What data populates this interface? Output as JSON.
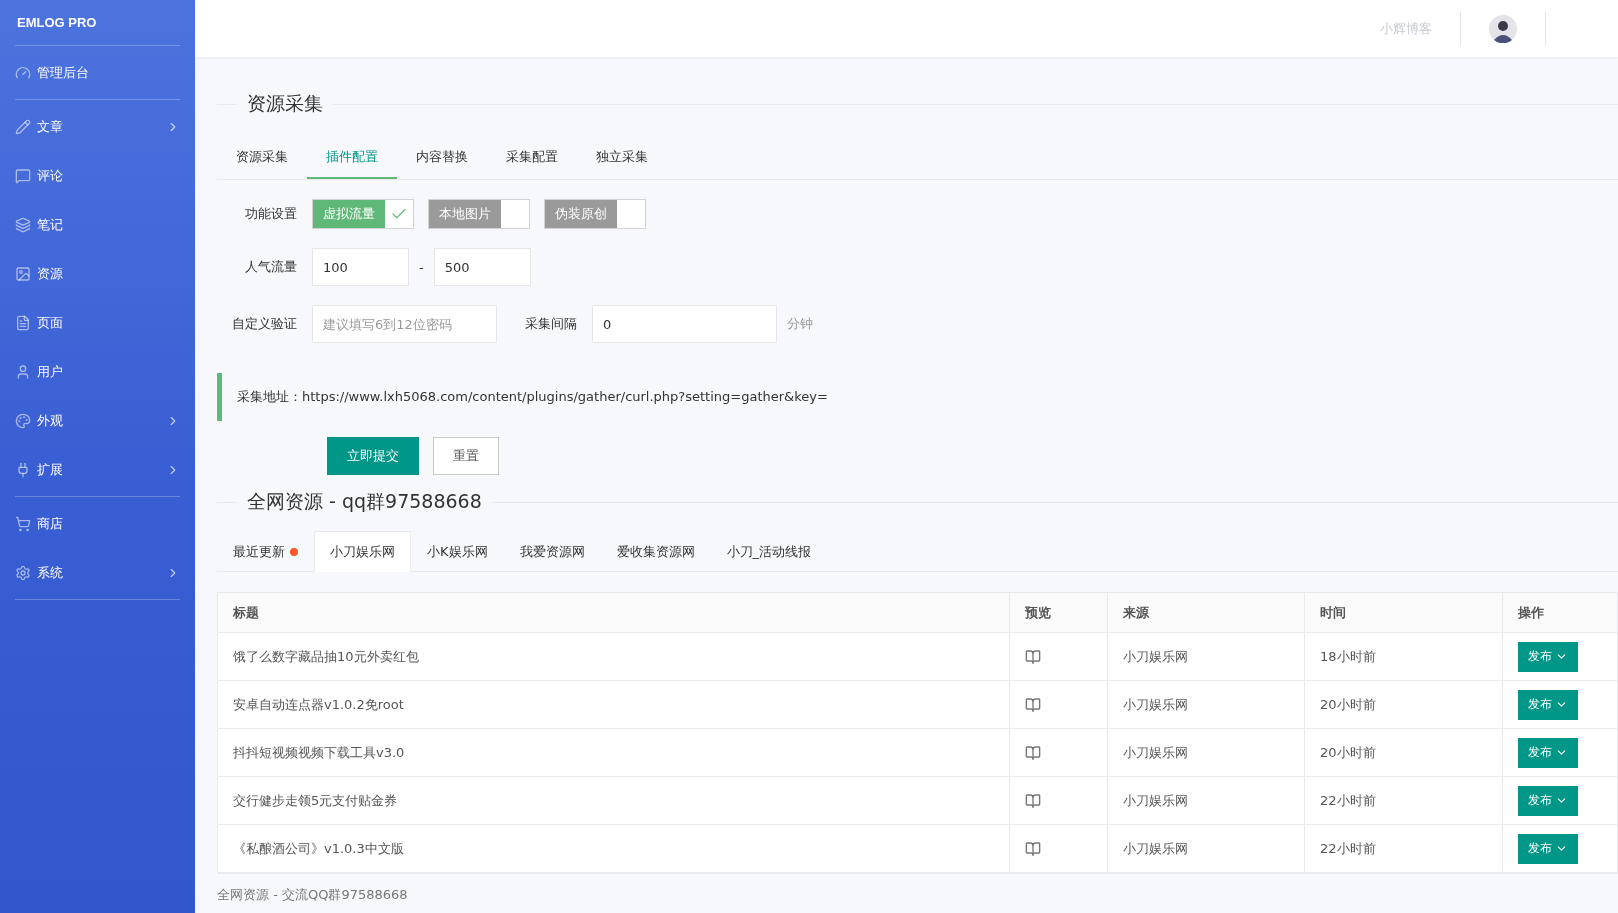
{
  "sidebar": {
    "brand": "EMLOG PRO",
    "sections": [
      {
        "items": [
          {
            "label": "管理后台",
            "has_submenu": false
          }
        ]
      },
      {
        "items": [
          {
            "label": "文章",
            "has_submenu": true
          },
          {
            "label": "评论",
            "has_submenu": false
          },
          {
            "label": "笔记",
            "has_submenu": false
          },
          {
            "label": "资源",
            "has_submenu": false
          },
          {
            "label": "页面",
            "has_submenu": false
          },
          {
            "label": "用户",
            "has_submenu": false
          },
          {
            "label": "外观",
            "has_submenu": true
          },
          {
            "label": "扩展",
            "has_submenu": true
          }
        ]
      },
      {
        "items": [
          {
            "label": "商店",
            "has_submenu": false
          },
          {
            "label": "系统",
            "has_submenu": true
          }
        ]
      }
    ]
  },
  "header": {
    "blog_name": "小辉博客"
  },
  "section_title": "资源采集",
  "tabs": [
    {
      "label": "资源采集",
      "selected": false
    },
    {
      "label": "插件配置",
      "selected": true
    },
    {
      "label": "内容替换",
      "selected": false
    },
    {
      "label": "采集配置",
      "selected": false
    },
    {
      "label": "独立采集",
      "selected": false
    }
  ],
  "form": {
    "feature_label": "功能设置",
    "toggles": [
      {
        "label": "虚拟流量",
        "on": true
      },
      {
        "label": "本地图片",
        "on": false
      },
      {
        "label": "伪装原创",
        "on": false
      }
    ],
    "traffic_label": "人气流量",
    "traffic_min": "100",
    "traffic_sep": "-",
    "traffic_max": "500",
    "verify_label": "自定义验证",
    "verify_placeholder": "建议填写6到12位密码",
    "interval_label": "采集间隔",
    "interval_value": "0",
    "interval_unit": "分钟",
    "notice": "采集地址：https://www.lxh5068.com/content/plugins/gather/curl.php?setting=gather&key=",
    "submit": "立即提交",
    "reset": "重置"
  },
  "resources_title": "全网资源 - qq群97588668",
  "source_tabs": [
    {
      "label": "最近更新",
      "selected": false,
      "has_new": true
    },
    {
      "label": "小刀娱乐网",
      "selected": true,
      "has_new": false
    },
    {
      "label": "小K娱乐网",
      "selected": false,
      "has_new": false
    },
    {
      "label": "我爱资源网",
      "selected": false,
      "has_new": false
    },
    {
      "label": "爱收集资源网",
      "selected": false,
      "has_new": false
    },
    {
      "label": "小刀_活动线报",
      "selected": false,
      "has_new": false
    }
  ],
  "table": {
    "columns": [
      "标题",
      "预览",
      "来源",
      "时间",
      "操作"
    ],
    "rows": [
      {
        "title": "饿了么数字藏品抽10元外卖红包",
        "source": "小刀娱乐网",
        "time": "18小时前",
        "action": "发布"
      },
      {
        "title": "安卓自动连点器v1.0.2免root",
        "source": "小刀娱乐网",
        "time": "20小时前",
        "action": "发布"
      },
      {
        "title": "抖抖短视频视频下载工具v3.0",
        "source": "小刀娱乐网",
        "time": "20小时前",
        "action": "发布"
      },
      {
        "title": "交行健步走领5元支付贴金券",
        "source": "小刀娱乐网",
        "time": "22小时前",
        "action": "发布"
      },
      {
        "title": "《私酿酒公司》v1.0.3中文版",
        "source": "小刀娱乐网",
        "time": "22小时前",
        "action": "发布"
      }
    ]
  },
  "footer": "全网资源 - 交流QQ群97588668"
}
